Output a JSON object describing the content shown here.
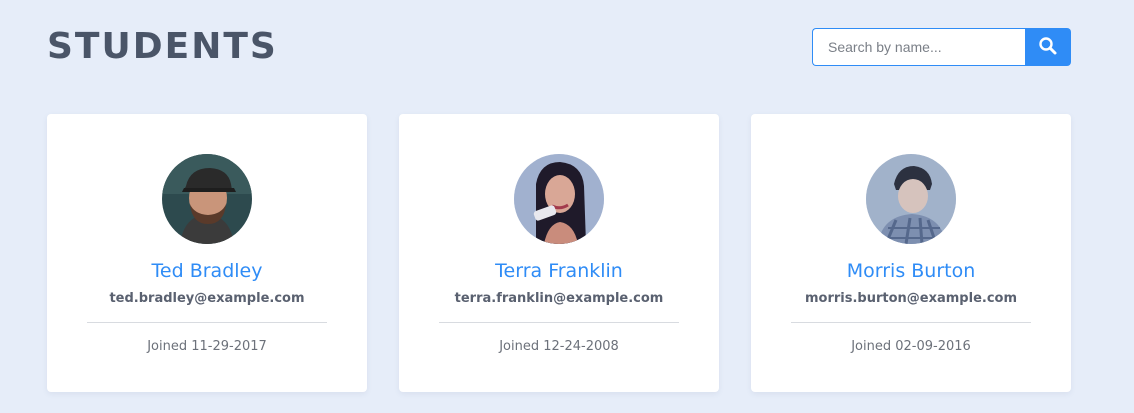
{
  "header": {
    "title": "STUDENTS"
  },
  "search": {
    "placeholder": "Search by name...",
    "value": "",
    "button_icon": "search-icon"
  },
  "colors": {
    "accent": "#2f8cf6",
    "background": "#e6edf9",
    "title": "#4a5568"
  },
  "students": [
    {
      "name": "Ted Bradley",
      "email": "ted.bradley@example.com",
      "joined": "Joined 11-29-2017"
    },
    {
      "name": "Terra Franklin",
      "email": "terra.franklin@example.com",
      "joined": "Joined 12-24-2008"
    },
    {
      "name": "Morris Burton",
      "email": "morris.burton@example.com",
      "joined": "Joined 02-09-2016"
    }
  ]
}
